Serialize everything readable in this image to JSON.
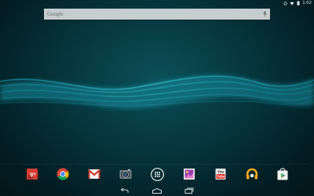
{
  "status_bar": {
    "time": "1:02",
    "icons": [
      "signal-icon",
      "wifi-icon",
      "battery-icon"
    ]
  },
  "search": {
    "label": "Google",
    "icon": "mic-icon"
  },
  "dock": {
    "apps": [
      {
        "name": "google-plus-icon",
        "label": "g+"
      },
      {
        "name": "chrome-icon"
      },
      {
        "name": "gmail-icon"
      },
      {
        "name": "camera-icon"
      },
      {
        "name": "app-drawer-icon"
      },
      {
        "name": "gallery-icon"
      },
      {
        "name": "youtube-icon",
        "label": "You Tube"
      },
      {
        "name": "play-music-icon"
      },
      {
        "name": "play-store-icon"
      }
    ]
  },
  "nav": {
    "buttons": [
      "back-icon",
      "home-icon",
      "recents-icon"
    ]
  },
  "colors": {
    "wallpaper": "#06343c",
    "wave": "#1fb7c9",
    "search_bg": "#f0f0f0"
  }
}
